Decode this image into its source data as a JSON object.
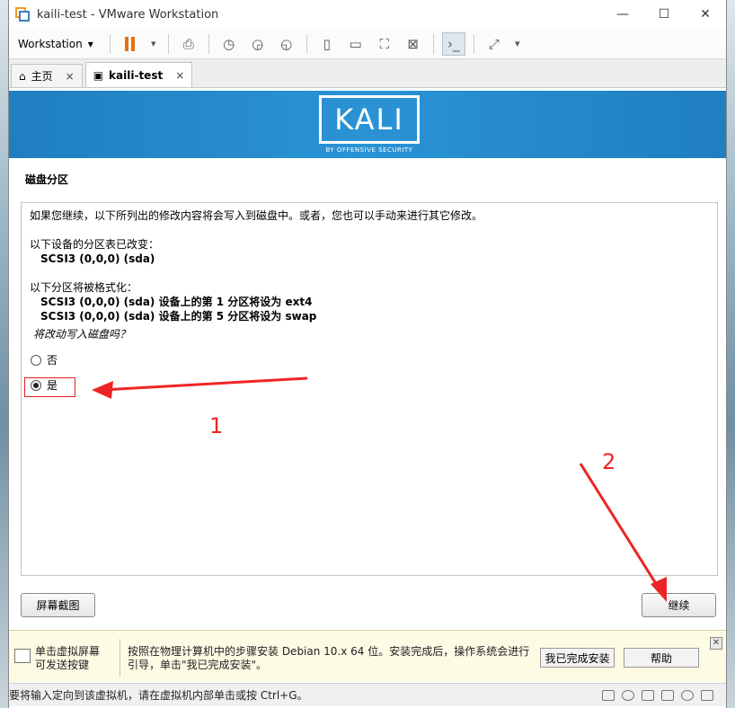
{
  "window": {
    "title": "kaili-test - VMware Workstation"
  },
  "toolbar": {
    "menu_label": "Workstation"
  },
  "tabs": [
    {
      "label": "主页",
      "icon": "home-icon"
    },
    {
      "label": "kaili-test",
      "icon": "vm-icon"
    }
  ],
  "banner": {
    "logo_text": "KALI",
    "logo_sub": "BY OFFENSIVE SECURITY"
  },
  "installer": {
    "section_title": "磁盘分区",
    "intro": "如果您继续，以下所列出的修改内容将会写入到磁盘中。或者，您也可以手动来进行其它修改。",
    "changed_heading": "以下设备的分区表已改变：",
    "changed_device": "SCSI3 (0,0,0) (sda)",
    "format_heading": "以下分区将被格式化：",
    "format_line1": "SCSI3 (0,0,0) (sda) 设备上的第 1 分区将设为 ext4",
    "format_line2": "SCSI3 (0,0,0) (sda) 设备上的第 5 分区将设为 swap",
    "question": "将改动写入磁盘吗？",
    "option_no": "否",
    "option_yes": "是",
    "screenshot_button": "屏幕截图",
    "continue_button": "继续"
  },
  "hint": {
    "left": "单击虚拟屏幕\n可发送按键",
    "main": "按照在物理计算机中的步骤安装 Debian 10.x 64 位。安装完成后，操作系统会进行引导，单击\"我已完成安装\"。",
    "done_button": "我已完成安装",
    "help_button": "帮助"
  },
  "statusbar": {
    "text": "要将输入定向到该虚拟机，请在虚拟机内部单击或按 Ctrl+G。"
  },
  "annotations": {
    "label1": "1",
    "label2": "2"
  },
  "colors": {
    "banner": "#2a93d5",
    "annotation": "#ee2424",
    "pause": "#e8700a"
  }
}
